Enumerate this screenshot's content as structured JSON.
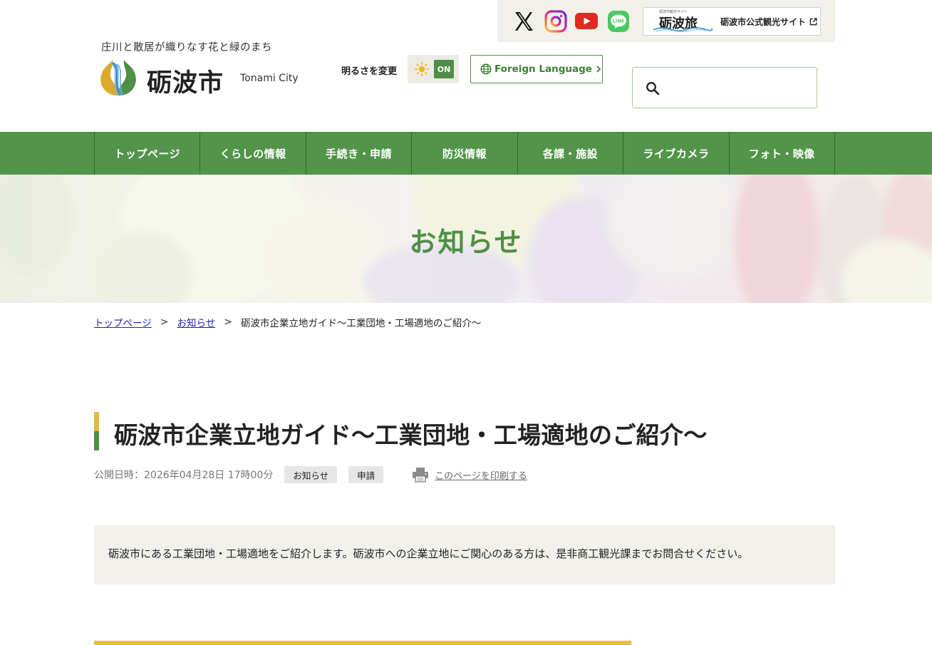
{
  "header": {
    "tagline": "庄川と散居が織りなす花と緑のまち",
    "logo_jp": "砺波市",
    "logo_en": "Tonami City",
    "brightness_label": "明るさを変更",
    "brightness_state": "ON",
    "foreign_language": "Foreign Language",
    "search_placeholder": "",
    "social": [
      "x-icon",
      "instagram-icon",
      "youtube-icon",
      "line-icon"
    ],
    "line_text": "LINE",
    "tour_logo_small": "砺波市観光サイト",
    "tour_logo_big": "砺波旅",
    "tour_label": "砺波市公式観光サイト"
  },
  "nav": {
    "items": [
      "トップページ",
      "くらしの情報",
      "手続き・申請",
      "防災情報",
      "各課・施設",
      "ライブカメラ",
      "フォト・映像"
    ]
  },
  "hero": {
    "title": "お知らせ"
  },
  "breadcrumb": {
    "home": "トップページ",
    "parent": "お知らせ",
    "sep": ">",
    "current": "砺波市企業立地ガイド〜工業団地・工場適地のご紹介〜"
  },
  "page": {
    "title": "砺波市企業立地ガイド〜工業団地・工場適地のご紹介〜",
    "published": "公開日時：2026年04月28日 17時00分",
    "tags": [
      "お知らせ",
      "申請"
    ],
    "print_label": "このページを印刷する",
    "intro": "砺波市にある工業団地・工場適地をご紹介します。砺波市への企業立地にご関心のある方は、是非商工観光課までお問合せください。"
  },
  "colors": {
    "brand_green": "#52944a",
    "accent_yellow": "#e2b83e",
    "link_blue": "#1f1fb0",
    "panel_bg": "#f1f0ea"
  }
}
